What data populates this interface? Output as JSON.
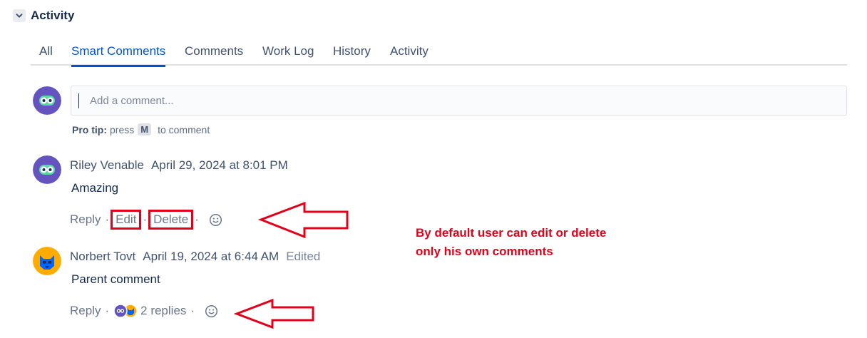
{
  "section": {
    "title": "Activity",
    "toggle_icon": "chevron-down-icon"
  },
  "tabs": [
    {
      "label": "All",
      "active": false
    },
    {
      "label": "Smart Comments",
      "active": true
    },
    {
      "label": "Comments",
      "active": false
    },
    {
      "label": "Work Log",
      "active": false
    },
    {
      "label": "History",
      "active": false
    },
    {
      "label": "Activity",
      "active": false
    }
  ],
  "composer": {
    "placeholder": "Add a comment...",
    "protip_label": "Pro tip:",
    "protip_press": "press",
    "protip_key": "M",
    "protip_suffix": "to comment"
  },
  "comments": [
    {
      "author": "Riley Venable",
      "timestamp": "April 29, 2024 at 8:01 PM",
      "edited": "",
      "body": "Amazing",
      "actions": {
        "reply": "Reply",
        "edit": "Edit",
        "delete": "Delete"
      },
      "avatar_color": "#6554c0"
    },
    {
      "author": "Norbert Tovt",
      "timestamp": "April 19, 2024 at 6:44 AM",
      "edited": "Edited",
      "body": "Parent comment",
      "actions": {
        "reply": "Reply",
        "replies": "2 replies"
      },
      "avatar_color": "#ffab00"
    }
  ],
  "annotation": {
    "line1": "By default user can edit or delete",
    "line2": "only his own comments",
    "color": "#e3001b"
  },
  "colors": {
    "accent": "#0052cc",
    "annotation": "#e3001b",
    "text": "#172b4d",
    "muted": "#6b778c"
  }
}
